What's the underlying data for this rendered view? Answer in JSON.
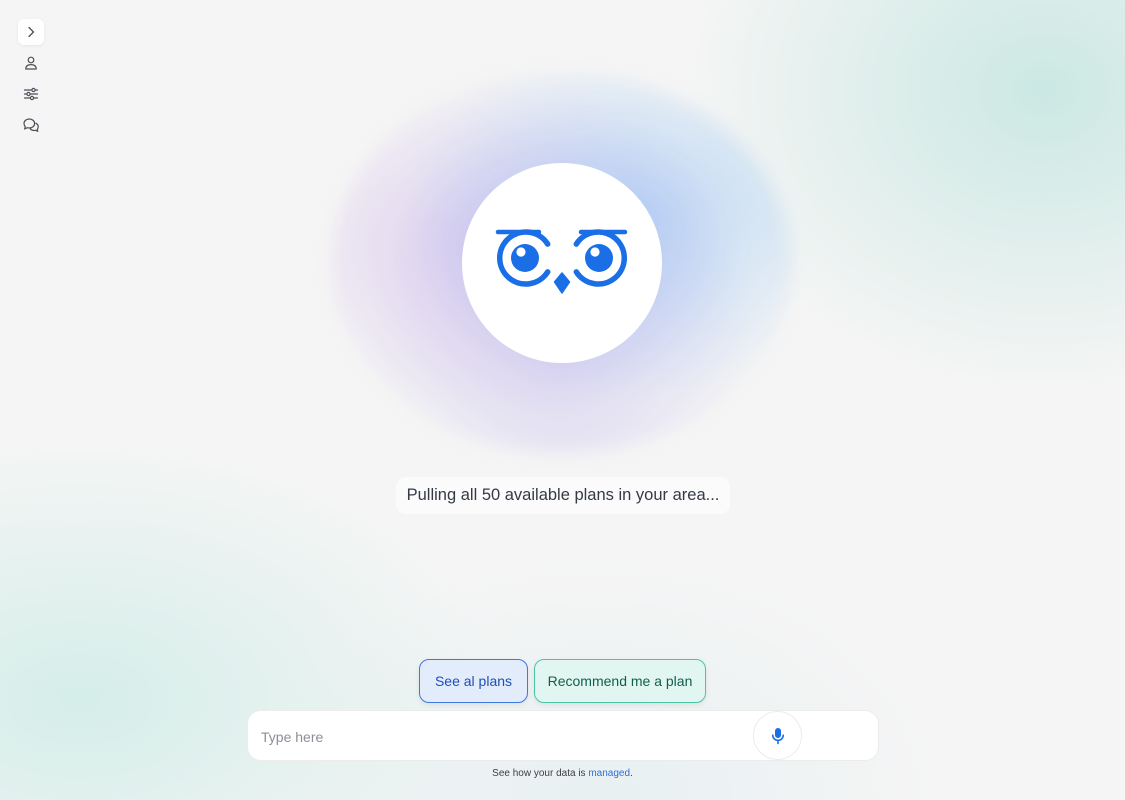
{
  "sidebar": {
    "items": [
      {
        "icon": "chevron-right-icon"
      },
      {
        "icon": "user-icon"
      },
      {
        "icon": "sliders-icon"
      },
      {
        "icon": "chat-icon"
      }
    ]
  },
  "avatar": {
    "icon": "owl-icon",
    "color": "#1a6fe6"
  },
  "status": {
    "text": "Pulling all 50 available plans in your area..."
  },
  "actions": {
    "see_all_label": "See al plans",
    "recommend_label": "Recommend me a plan"
  },
  "input": {
    "placeholder": "Type here",
    "value": "",
    "mic_icon": "microphone-icon"
  },
  "footer": {
    "prefix": "See how your data is ",
    "link_text": "managed",
    "suffix": "."
  },
  "colors": {
    "accent": "#1a6fe6",
    "see_all_border": "#3f78e0",
    "recommend_border": "#4cc5a6",
    "link": "#2f6fdc"
  }
}
